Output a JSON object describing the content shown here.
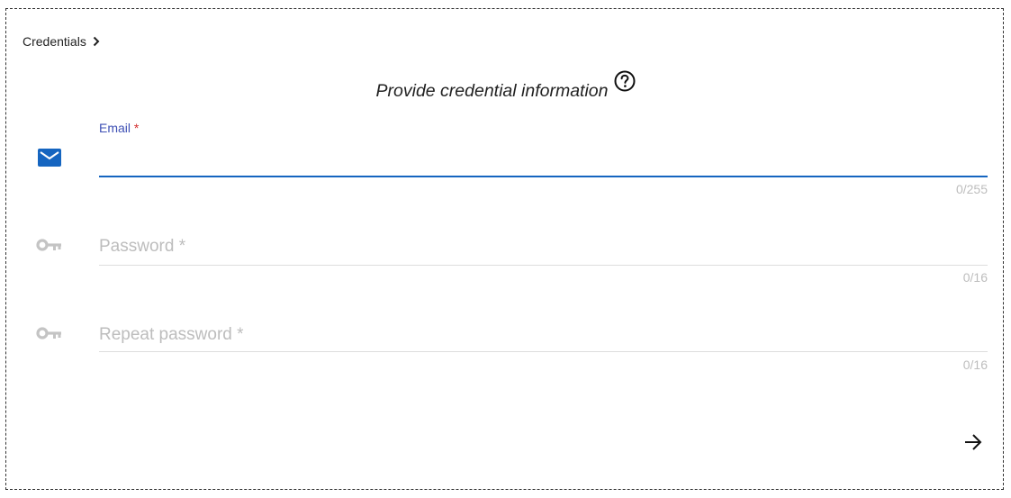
{
  "breadcrumb": {
    "label": "Credentials"
  },
  "form": {
    "title": "Provide credential information",
    "help_icon": "help-circle-icon",
    "next_icon": "arrow-right-icon"
  },
  "fields": {
    "email": {
      "label": "Email",
      "required_mark": "*",
      "value": "",
      "counter": "0/255",
      "icon": "email-icon",
      "icon_color": "#1565c0"
    },
    "password": {
      "placeholder": "Password *",
      "value": "",
      "counter": "0/16",
      "icon": "key-icon",
      "icon_color": "#c4c4c4"
    },
    "repeat_password": {
      "placeholder": "Repeat password *",
      "value": "",
      "counter": "0/16",
      "icon": "key-icon",
      "icon_color": "#c4c4c4"
    }
  },
  "colors": {
    "accent": "#1565c0",
    "label": "#3f51b5",
    "required": "#d32f2f",
    "muted": "#bdbdbd"
  }
}
